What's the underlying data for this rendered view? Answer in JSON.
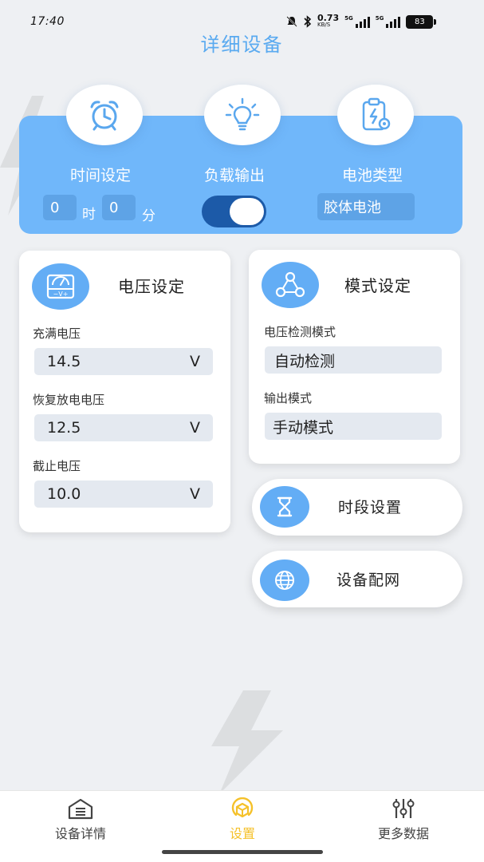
{
  "status_bar": {
    "time": "17:40",
    "net_speed": "0.73",
    "net_unit": "KB/S",
    "sim1": "5G",
    "sim2": "5G",
    "battery": "83"
  },
  "page_title": "详细设备",
  "top_panel": {
    "time_setting_label": "时间设定",
    "load_output_label": "负载输出",
    "battery_type_label": "电池类型",
    "hour_value": "0",
    "hour_unit": "时",
    "minute_value": "0",
    "minute_unit": "分",
    "load_output_on": true,
    "battery_type_value": "胶体电池",
    "accent_color": "#70b7fa"
  },
  "voltage_card": {
    "title": "电压设定",
    "fields": [
      {
        "label": "充满电压",
        "value": "14.5",
        "unit": "V"
      },
      {
        "label": "恢复放电电压",
        "value": "12.5",
        "unit": "V"
      },
      {
        "label": "截止电压",
        "value": "10.0",
        "unit": "V"
      }
    ]
  },
  "mode_card": {
    "title": "模式设定",
    "fields": [
      {
        "label": "电压检测模式",
        "value": "自动检测"
      },
      {
        "label": "输出模式",
        "value": "手动模式"
      }
    ]
  },
  "period_button": {
    "label": "时段设置",
    "icon": "hourglass-icon"
  },
  "network_button": {
    "label": "设备配网",
    "icon": "globe-icon"
  },
  "bottom_nav": {
    "items": [
      {
        "label": "设备详情",
        "icon": "device-home-icon",
        "active": false
      },
      {
        "label": "设置",
        "icon": "settings-cube-icon",
        "active": true
      },
      {
        "label": "更多数据",
        "icon": "sliders-icon",
        "active": false
      }
    ],
    "active_color": "#f5c12a"
  }
}
